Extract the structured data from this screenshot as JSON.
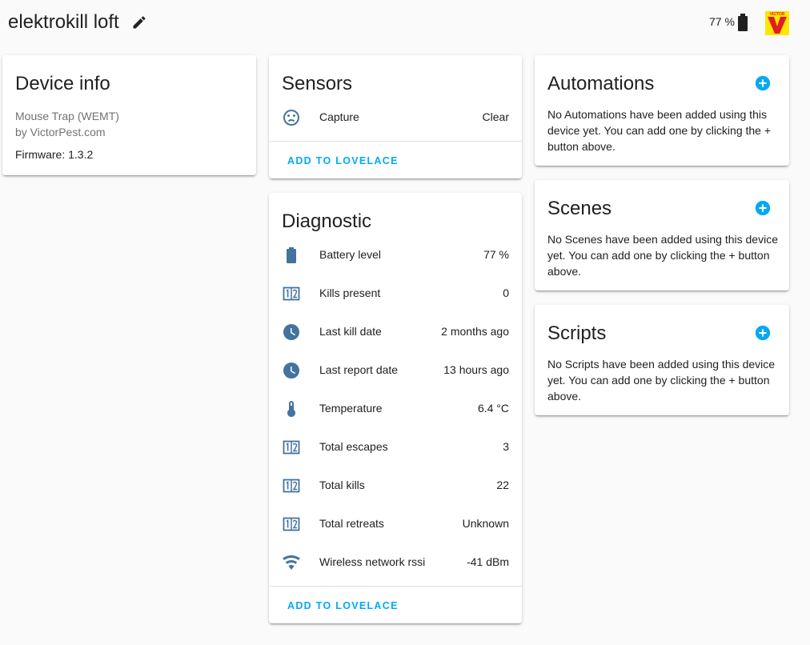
{
  "header": {
    "device_name": "elektrokill loft",
    "battery": "77 %"
  },
  "device_info": {
    "title": "Device info",
    "model": "Mouse Trap (WEMT)",
    "manufacturer": "by VictorPest.com",
    "firmware": "Firmware: 1.3.2"
  },
  "sensors": {
    "title": "Sensors",
    "items": [
      {
        "name": "Capture",
        "value": "Clear",
        "icon": "emoticon-sad-icon"
      }
    ],
    "action": "ADD TO LOVELACE"
  },
  "diagnostic": {
    "title": "Diagnostic",
    "items": [
      {
        "name": "Battery level",
        "value": "77 %",
        "icon": "battery-icon"
      },
      {
        "name": "Kills present",
        "value": "0",
        "icon": "numeric-icon"
      },
      {
        "name": "Last kill date",
        "value": "2 months ago",
        "icon": "clock-icon"
      },
      {
        "name": "Last report date",
        "value": "13 hours ago",
        "icon": "clock-icon"
      },
      {
        "name": "Temperature",
        "value": "6.4 °C",
        "icon": "thermometer-icon"
      },
      {
        "name": "Total escapes",
        "value": "3",
        "icon": "numeric-icon"
      },
      {
        "name": "Total kills",
        "value": "22",
        "icon": "numeric-icon"
      },
      {
        "name": "Total retreats",
        "value": "Unknown",
        "icon": "numeric-icon"
      },
      {
        "name": "Wireless network rssi",
        "value": "-41 dBm",
        "icon": "wifi-icon"
      }
    ],
    "action": "ADD TO LOVELACE"
  },
  "automations": {
    "title": "Automations",
    "text": "No Automations have been added using this device yet. You can add one by clicking the + button above."
  },
  "scenes": {
    "title": "Scenes",
    "text": "No Scenes have been added using this device yet. You can add one by clicking the + button above."
  },
  "scripts": {
    "title": "Scripts",
    "text": "No Scripts have been added using this device yet. You can add one by clicking the + button above."
  },
  "colors": {
    "accent": "#03a9f4",
    "icon": "#44739e",
    "logo_red": "#e31b23",
    "logo_yellow": "#ffe600"
  }
}
